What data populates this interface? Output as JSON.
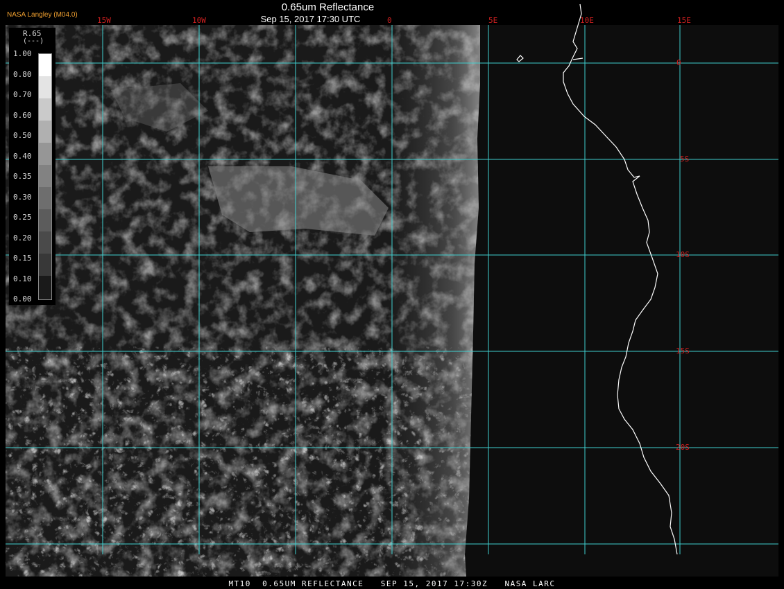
{
  "header": {
    "org": "NASA Langley (M04.0)",
    "title": "0.65um Reflectance",
    "timestamp": "Sep 15, 2017 17:30 UTC"
  },
  "footer": {
    "text": "MT10  0.65UM REFLECTANCE   SEP 15, 2017 17:30Z   NASA LARC"
  },
  "legend": {
    "title": "R.65",
    "unit": "(---)",
    "ticks": [
      "1.00",
      "0.80",
      "0.70",
      "0.60",
      "0.50",
      "0.40",
      "0.35",
      "0.30",
      "0.25",
      "0.20",
      "0.15",
      "0.10",
      "0.00"
    ]
  },
  "grid": {
    "lon_labels": [
      "15W",
      "10W",
      "0",
      "5E",
      "10E",
      "15E"
    ],
    "lat_labels": [
      "0",
      "5S",
      "10S",
      "15S",
      "20S"
    ]
  },
  "colors": {
    "gridline": "#40d0d0",
    "grid_label": "#d02020",
    "header_org": "#f0a030",
    "coastline": "#ffffff"
  }
}
